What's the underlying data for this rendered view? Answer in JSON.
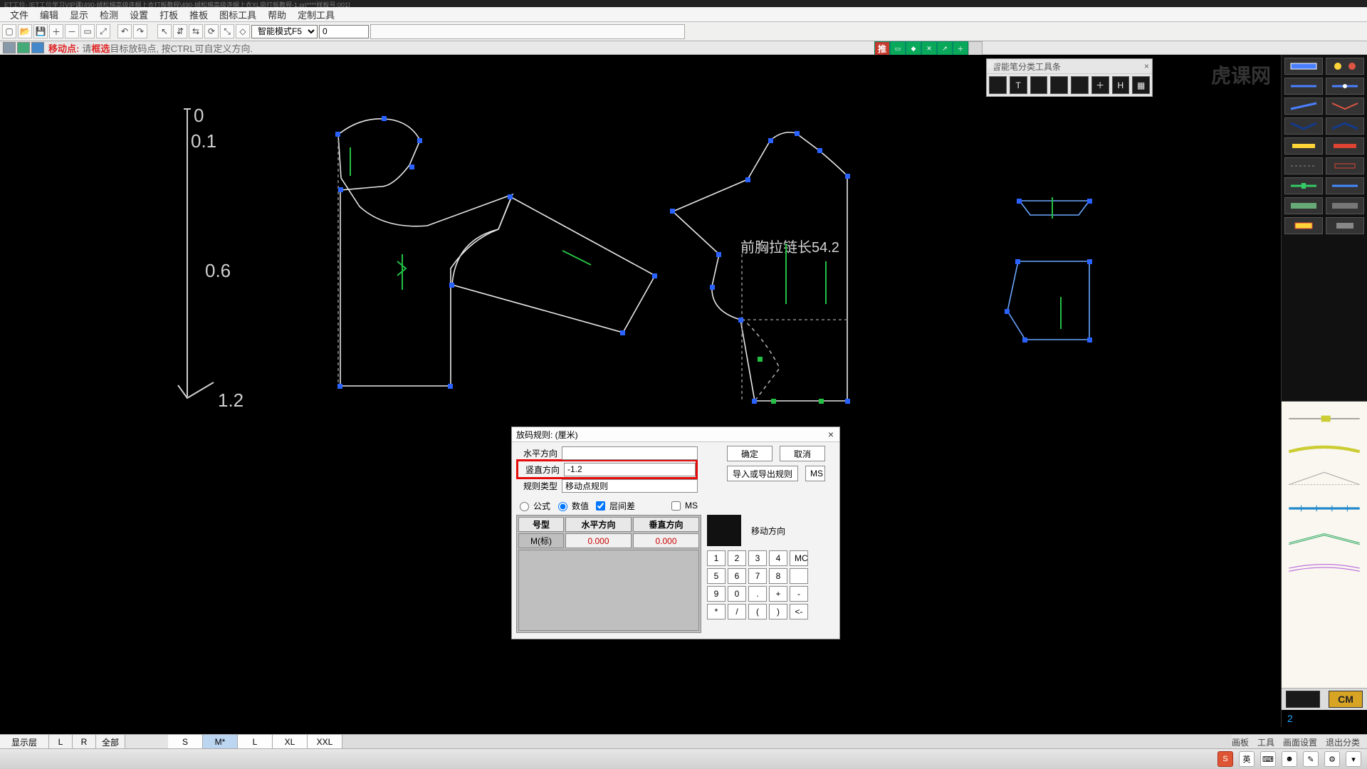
{
  "titlebar": "ET工位- [ET工位学习VIP课(490-绒松棉高级连帽上衣打板教程\\490-绒松棉高级连帽上衣XL岗打板教程-1.prj****样板号:001]",
  "menu": [
    "文件",
    "编辑",
    "显示",
    "检测",
    "设置",
    "打板",
    "推板",
    "图标工具",
    "帮助",
    "定制工具"
  ],
  "toolbar": {
    "icons": [
      "new-file",
      "open-file",
      "save",
      "zoom-in",
      "zoom-out",
      "rect-select",
      "undo",
      "redo",
      "sep",
      "pointer",
      "mirror-h",
      "mirror-v",
      "rotate",
      "scale",
      "notch"
    ],
    "mode_label": "智能模式F5",
    "num_value": "0"
  },
  "hint": {
    "action_label": "移动点:",
    "pre": "请",
    "strong": "框选",
    "rest": "目标放码点, 按CTRL可自定义方向.",
    "推_label": "推"
  },
  "smartpen": {
    "title": "智能笔分类工具条"
  },
  "canvas": {
    "ruler": {
      "v0": "0",
      "v1": "0.1",
      "v2": "0.6",
      "v3": "1.2"
    },
    "text1": "前胸拉链长54.2"
  },
  "dialog": {
    "title": "放码规则: (厘米)",
    "h_label": "水平方向",
    "h_value": "",
    "v_label": "竖直方向",
    "v_value": "-1.2",
    "type_label": "规则类型",
    "type_value": "移动点规则",
    "ok": "确定",
    "cancel": "取消",
    "import": "导入或导出规则",
    "ms": "MS",
    "r_formula": "公式",
    "r_value": "数值",
    "c_step": "层间差",
    "c_ms": "MS",
    "th_size": "号型",
    "th_h": "水平方向",
    "th_v": "垂直方向",
    "row_size": "M(标)",
    "row_h": "0.000",
    "row_v": "0.000",
    "move_label": "移动方向",
    "keypad": [
      "1",
      "2",
      "3",
      "4",
      "MC",
      "5",
      "6",
      "7",
      "8",
      " ",
      "9",
      "0",
      ".",
      "+",
      "-",
      "*",
      "/",
      "(",
      ")",
      "<-"
    ]
  },
  "sizebar": {
    "label": "显示层",
    "codes": [
      "L",
      "R",
      "全部"
    ],
    "sizes": [
      "S",
      "M*",
      "L",
      "XL",
      "XXL"
    ],
    "right": [
      "画板",
      "工具",
      "画面设置",
      "退出分类"
    ]
  },
  "rpanel": {
    "cm": "CM",
    "num": "2"
  },
  "taskbar": {
    "ime": "英"
  },
  "watermark": "虎课网"
}
